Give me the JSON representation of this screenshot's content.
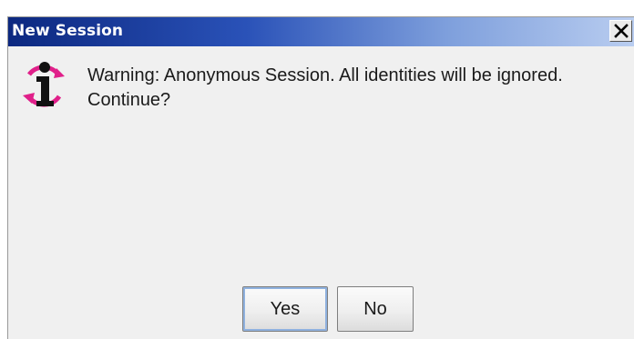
{
  "dialog": {
    "title": "New Session",
    "close_glyph": "✕",
    "icon": "info-icon",
    "message": "Warning: Anonymous Session. All identities will be ignored. Continue?",
    "buttons": {
      "yes_label": "Yes",
      "no_label": "No"
    }
  },
  "colors": {
    "titlebar_start": "#0c2880",
    "titlebar_end": "#b9cdf0",
    "icon_accent": "#e0208a",
    "background": "#f0f0f0"
  }
}
